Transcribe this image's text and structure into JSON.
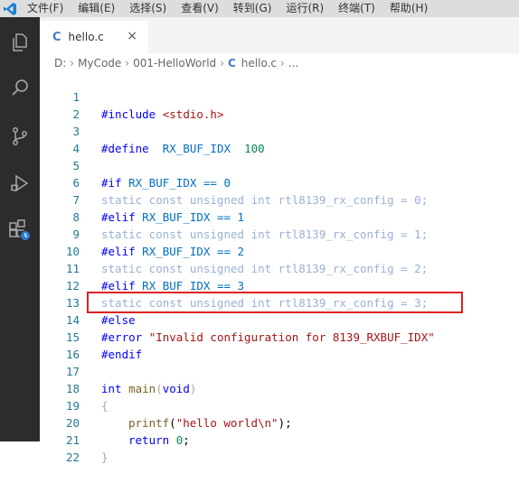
{
  "menu": [
    "文件(F)",
    "编辑(E)",
    "选择(S)",
    "查看(V)",
    "转到(G)",
    "运行(R)",
    "终端(T)",
    "帮助(H)"
  ],
  "tab": {
    "icon": "C",
    "label": "hello.c",
    "close": "×"
  },
  "breadcrumb": {
    "drive": "D:",
    "folder1": "MyCode",
    "folder2": "001-HelloWorld",
    "icon": "C",
    "file": "hello.c",
    "more": "..."
  },
  "code": {
    "l1": "1",
    "l1_pp": "#include",
    "l1_inc": "<stdio.h>",
    "l3": "3",
    "l3_pp": "#define",
    "l3_name": "RX_BUF_IDX",
    "l3_val": "100",
    "l5": "5",
    "l5_pp": "#if",
    "l5_expr": "RX_BUF_IDX == 0",
    "l6": "6",
    "l6_text": "static const unsigned int rtl8139_rx_config = 0;",
    "l7": "7",
    "l7_pp": "#elif",
    "l7_expr": "RX_BUF_IDX == 1",
    "l8": "8",
    "l8_text": "static const unsigned int rtl8139_rx_config = 1;",
    "l9": "9",
    "l9_pp": "#elif",
    "l9_expr": "RX_BUF_IDX == 2",
    "l10": "10",
    "l10_text": "static const unsigned int rtl8139_rx_config = 2;",
    "l11": "11",
    "l11_pp": "#elif",
    "l11_expr": "RX_BUF_IDX == 3",
    "l12": "12",
    "l12_text": "static const unsigned int rtl8139_rx_config = 3;",
    "l13": "13",
    "l13_pp": "#else",
    "l14": "14",
    "l14_pp": "#error",
    "l14_str": "\"Invalid configuration for 8139_RXBUF_IDX\"",
    "l15": "15",
    "l15_pp": "#endif",
    "l16": "16",
    "l17": "17",
    "l17_type": "int",
    "l17_fn": "main",
    "l17_open": "(",
    "l17_param": "void",
    "l17_close": ")",
    "l18": "18",
    "l18_brace": "{",
    "l19": "19",
    "l19_fn": "printf",
    "l19_open": "(",
    "l19_str": "\"hello world\\n\"",
    "l19_close": ");",
    "l20": "20",
    "l20_kw": "return",
    "l20_num": "0",
    "l20_semi": ";",
    "l21": "21",
    "l21_brace": "}",
    "l22": "22",
    "l2": "2",
    "l4": "4"
  },
  "colors": {
    "highlight_box": "#e02020",
    "line_number": "#237893"
  }
}
